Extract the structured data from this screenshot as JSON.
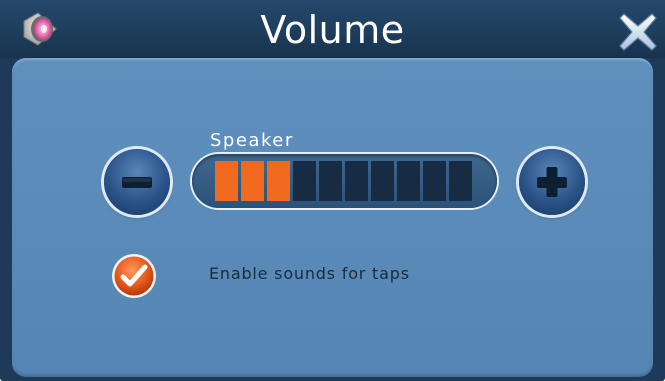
{
  "window": {
    "title": "Volume"
  },
  "icons": {
    "title_icon": "speaker-icon",
    "close": "close-icon",
    "decrease": "minus-icon",
    "increase": "plus-icon",
    "check": "checkmark-icon"
  },
  "volume": {
    "label": "Speaker",
    "level": 3,
    "max_level": 10,
    "filled_color": "#f26a1f",
    "empty_color": "#172b42"
  },
  "tap_sounds": {
    "label": "Enable sounds for taps",
    "checked": true,
    "color": "#ea5a1e"
  },
  "colors": {
    "titlebar": "#1e3e5d",
    "panel": "#5b8cba",
    "button": "#2a5388"
  }
}
